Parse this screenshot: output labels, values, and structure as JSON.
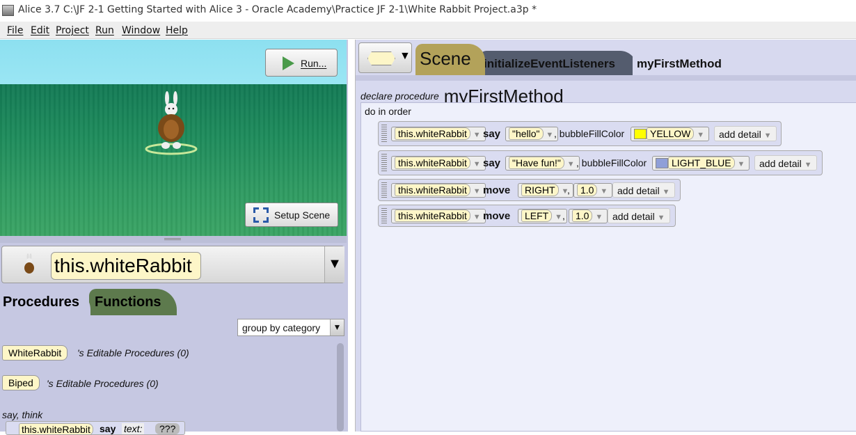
{
  "window": {
    "title": "Alice 3.7 C:\\JF 2-1 Getting Started with Alice 3  - Oracle Academy\\Practice JF 2-1\\White Rabbit Project.a3p *"
  },
  "menu": [
    "File",
    "Edit",
    "Project",
    "Run",
    "Window",
    "Help"
  ],
  "scene": {
    "run_label": "Run...",
    "setup_label": "Setup Scene"
  },
  "selector": {
    "value": "this.whiteRabbit"
  },
  "panel": {
    "tab_procedures": "Procedures",
    "tab_functions": "Functions",
    "group_by": "group by category",
    "groups": [
      {
        "type": "WhiteRabbit",
        "text": "'s Editable Procedures (0)"
      },
      {
        "type": "Biped",
        "text": "'s Editable Procedures (0)"
      }
    ],
    "category": "say, think",
    "snippet": {
      "target": "this.whiteRabbit",
      "verb": "say",
      "param": "text:",
      "value": "???"
    }
  },
  "editor": {
    "tabs": [
      "Scene",
      "initializeEventListeners",
      "myFirstMethod"
    ],
    "declare_label": "declare procedure",
    "method_name": "myFirstMethod",
    "do_in_order": "do in order",
    "statements": [
      {
        "target": "this.whiteRabbit",
        "verb": "say",
        "arg": "\"hello\"",
        "sep": ", bubbleFillColor",
        "color_name": "YELLOW",
        "color": "#ffff00",
        "add": "add detail"
      },
      {
        "target": "this.whiteRabbit",
        "verb": "say",
        "arg": "\"Have fun!\"",
        "sep": ", bubbleFillColor",
        "color_name": "LIGHT_BLUE",
        "color": "#8f9fd8",
        "add": "add detail"
      },
      {
        "target": "this.whiteRabbit",
        "verb": "move",
        "arg": "RIGHT",
        "sep": ",",
        "amount": "1.0",
        "add": "add detail"
      },
      {
        "target": "this.whiteRabbit",
        "verb": "move",
        "arg": "LEFT",
        "sep": ",",
        "amount": "1.0",
        "add": "add detail"
      }
    ]
  }
}
